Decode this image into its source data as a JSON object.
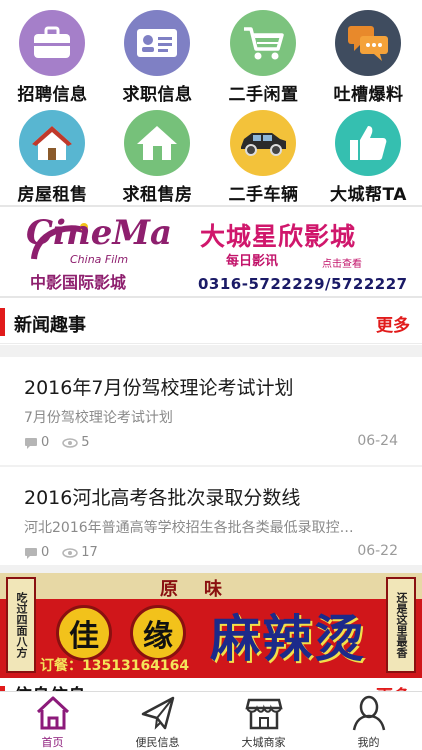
{
  "categories": [
    {
      "label": "招聘信息",
      "icon": "briefcase-icon",
      "color": "#a57fc9"
    },
    {
      "label": "求职信息",
      "icon": "id-card-icon",
      "color": "#7f80c4"
    },
    {
      "label": "二手闲置",
      "icon": "shopping-cart-icon",
      "color": "#7cc37e"
    },
    {
      "label": "吐槽爆料",
      "icon": "chat-bubbles-icon",
      "color": "#3f4c5f"
    },
    {
      "label": "房屋租售",
      "icon": "house-icon",
      "color": "#58b6d1"
    },
    {
      "label": "求租售房",
      "icon": "house-icon",
      "color": "#76c17a"
    },
    {
      "label": "二手车辆",
      "icon": "car-icon",
      "color": "#f3c23a"
    },
    {
      "label": "大城帮TA",
      "icon": "thumbs-up-icon",
      "color": "#35bfb0"
    }
  ],
  "cinema_banner": {
    "logo_word": "CineMa",
    "logo_sub": "China Film",
    "logo_cn": "中影国际影城",
    "title": "大城星欣影城",
    "daily": "每日影讯",
    "click": "点击查看",
    "phone": "0316-5722229/5722227"
  },
  "news_section": {
    "title": "新闻趣事",
    "more": "更多",
    "items": [
      {
        "title": "2016年7月份驾校理论考试计划",
        "summary": "7月份驾校理论考试计划",
        "comments": "0",
        "views": "5",
        "date": "06-24"
      },
      {
        "title": "2016河北高考各批次录取分数线",
        "summary": "河北2016年普通高等学校招生各批各类最低录取控…",
        "comments": "0",
        "views": "17",
        "date": "06-22"
      }
    ]
  },
  "mala_banner": {
    "yuanwei": "原味",
    "left_scroll": "吃过四面八方",
    "right_scroll": "还是这里最香",
    "disc1": "佳",
    "disc2": "缘",
    "big": "麻辣烫",
    "order": "订餐：13513164164"
  },
  "partial_section": {
    "title": "信息信息",
    "more": "更多"
  },
  "tabbar": [
    {
      "label": "首页",
      "icon": "home-icon",
      "active": true
    },
    {
      "label": "便民信息",
      "icon": "paper-plane-icon",
      "active": false
    },
    {
      "label": "大城商家",
      "icon": "storefront-icon",
      "active": false
    },
    {
      "label": "我的",
      "icon": "user-icon",
      "active": false
    }
  ],
  "colors": {
    "accent": "#e11b1b",
    "active_tab": "#8c1a7a",
    "gap": "#f1f1f1"
  }
}
